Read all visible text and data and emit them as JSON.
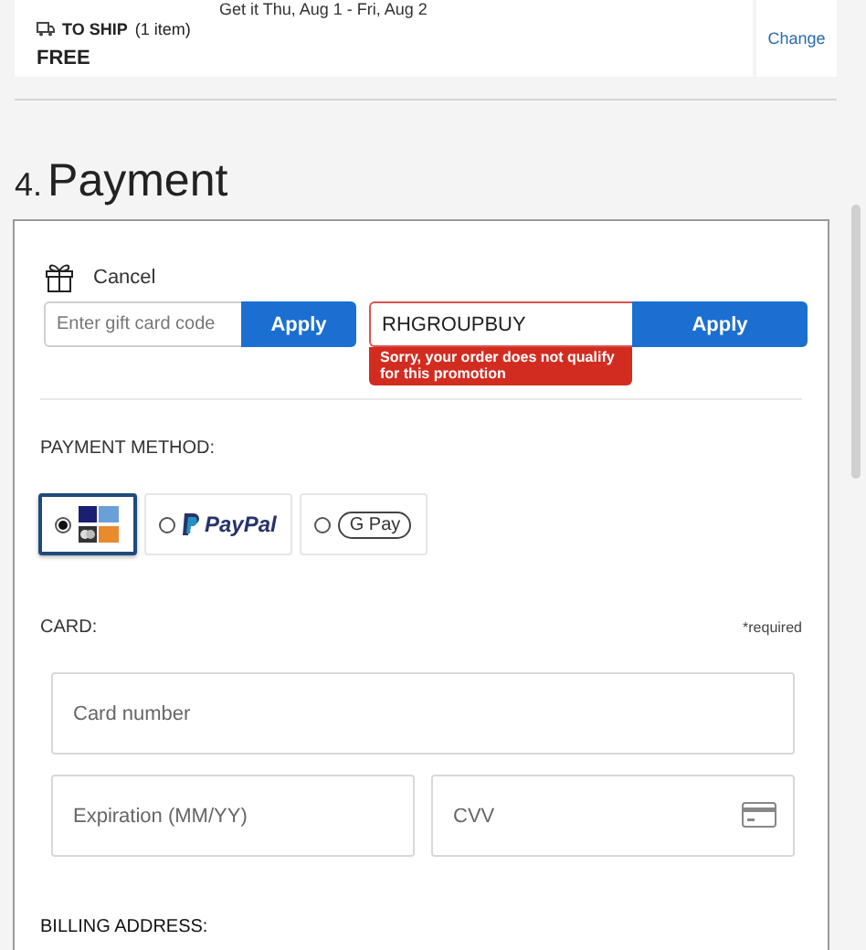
{
  "shipping": {
    "delivery": "Get it Thu, Aug 1 - Fri, Aug 2",
    "label": "TO SHIP",
    "count": "(1 item)",
    "price": "FREE",
    "change": "Change"
  },
  "section": {
    "number": "4.",
    "title": "Payment"
  },
  "gift_card": {
    "cancel": "Cancel",
    "placeholder": "Enter gift card code",
    "apply": "Apply"
  },
  "promo": {
    "value": "RHGROUPBUY",
    "apply": "Apply",
    "error": "Sorry, your order does not qualify for this promotion"
  },
  "payment_method": {
    "label": "PAYMENT METHOD:",
    "options": [
      {
        "kind": "cards",
        "selected": true
      },
      {
        "kind": "paypal",
        "label": "PayPal",
        "selected": false
      },
      {
        "kind": "gpay",
        "label": "G Pay",
        "selected": false
      }
    ]
  },
  "card": {
    "label": "CARD:",
    "required": "*required",
    "fields": [
      {
        "placeholder": "Card number",
        "kind": "full"
      },
      {
        "placeholder": "Expiration (MM/YY)",
        "kind": "half"
      },
      {
        "placeholder": "CVV",
        "kind": "cvv"
      }
    ]
  },
  "billing": {
    "label": "BILLING ADDRESS:"
  }
}
